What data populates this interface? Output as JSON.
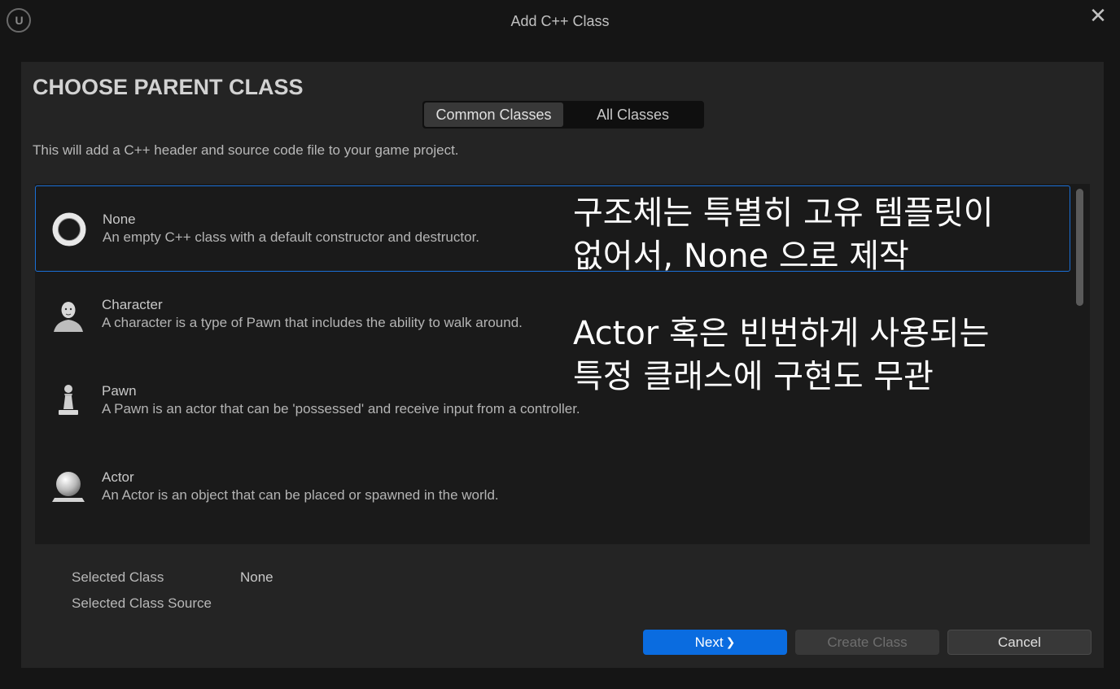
{
  "window": {
    "title": "Add C++ Class",
    "close_glyph": "✕",
    "logo_text": "U"
  },
  "panel": {
    "heading": "CHOOSE PARENT CLASS",
    "tabs": [
      {
        "label": "Common Classes",
        "active": true
      },
      {
        "label": "All Classes",
        "active": false
      }
    ],
    "description": "This will add a C++ header and source code file to your game project."
  },
  "classes": [
    {
      "name": "None",
      "description": "An empty C++ class with a default constructor and destructor.",
      "icon": "ring-icon",
      "selected": true
    },
    {
      "name": "Character",
      "description": "A character is a type of Pawn that includes the ability to walk around.",
      "icon": "character-icon",
      "selected": false
    },
    {
      "name": "Pawn",
      "description": "A Pawn is an actor that can be 'possessed' and receive input from a controller.",
      "icon": "pawn-icon",
      "selected": false
    },
    {
      "name": "Actor",
      "description": "An Actor is an object that can be placed or spawned in the world.",
      "icon": "actor-icon",
      "selected": false
    }
  ],
  "info": {
    "selected_class_label": "Selected Class",
    "selected_class_value": "None",
    "selected_class_source_label": "Selected Class Source"
  },
  "buttons": {
    "next": "Next",
    "next_glyph": "❯",
    "create": "Create Class",
    "cancel": "Cancel"
  },
  "annotations": {
    "first_line1": "구조체는 특별히 고유 템플릿이",
    "first_line2": "없어서, None 으로 제작",
    "second_line1": "Actor 혹은 빈번하게 사용되는",
    "second_line2": "특정 클래스에 구현도 무관"
  },
  "colors": {
    "accent": "#0a6ce0",
    "selection_border": "#1a6fd6",
    "panel_bg": "#242424",
    "list_bg": "#1a1a1a"
  }
}
